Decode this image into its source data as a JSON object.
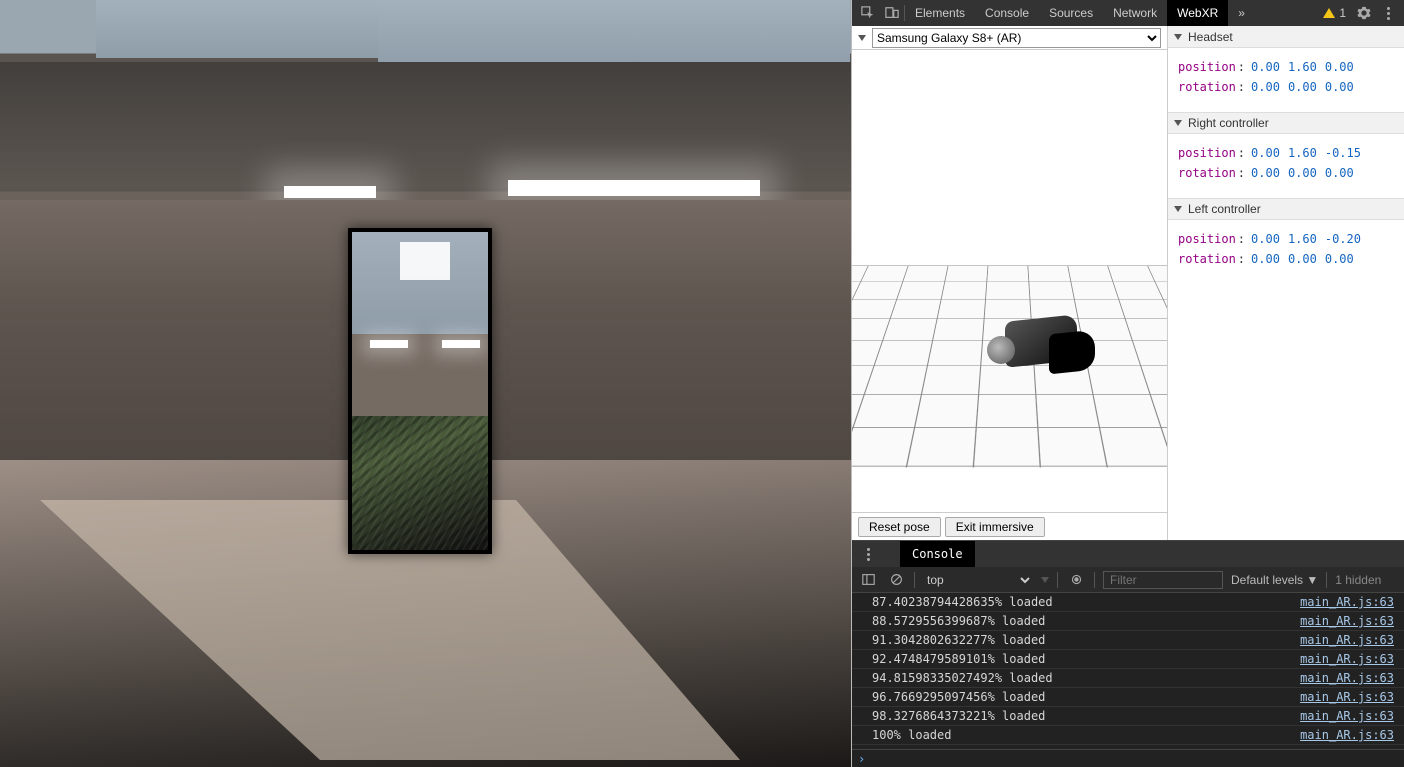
{
  "devtools": {
    "tabs": [
      "Elements",
      "Console",
      "Sources",
      "Network",
      "WebXR"
    ],
    "active_tab": "WebXR",
    "overflow": "»",
    "warning_count": "1"
  },
  "webxr": {
    "device_selected": "Samsung Galaxy S8+ (AR)",
    "buttons": {
      "reset": "Reset pose",
      "exit": "Exit immersive"
    },
    "sections": {
      "headset": {
        "title": "Headset",
        "position": {
          "label": "position",
          "x": "0.00",
          "y": "1.60",
          "z": "0.00"
        },
        "rotation": {
          "label": "rotation",
          "x": "0.00",
          "y": "0.00",
          "z": "0.00"
        }
      },
      "right": {
        "title": "Right controller",
        "position": {
          "label": "position",
          "x": "0.00",
          "y": "1.60",
          "z": "-0.15"
        },
        "rotation": {
          "label": "rotation",
          "x": "0.00",
          "y": "0.00",
          "z": "0.00"
        }
      },
      "left": {
        "title": "Left controller",
        "position": {
          "label": "position",
          "x": "0.00",
          "y": "1.60",
          "z": "-0.20"
        },
        "rotation": {
          "label": "rotation",
          "x": "0.00",
          "y": "0.00",
          "z": "0.00"
        }
      }
    }
  },
  "console": {
    "tab_label": "Console",
    "context": "top",
    "filter_placeholder": "Filter",
    "levels_label": "Default levels ▼",
    "hidden_label": "1 hidden",
    "source": "main_AR.js:63",
    "logs": [
      "87.40238794428635% loaded",
      "88.5729556399687% loaded",
      "91.3042802632277% loaded",
      "92.4748479589101% loaded",
      "94.81598335027492% loaded",
      "96.7669295097456% loaded",
      "98.3276864373221% loaded",
      "100% loaded"
    ]
  }
}
